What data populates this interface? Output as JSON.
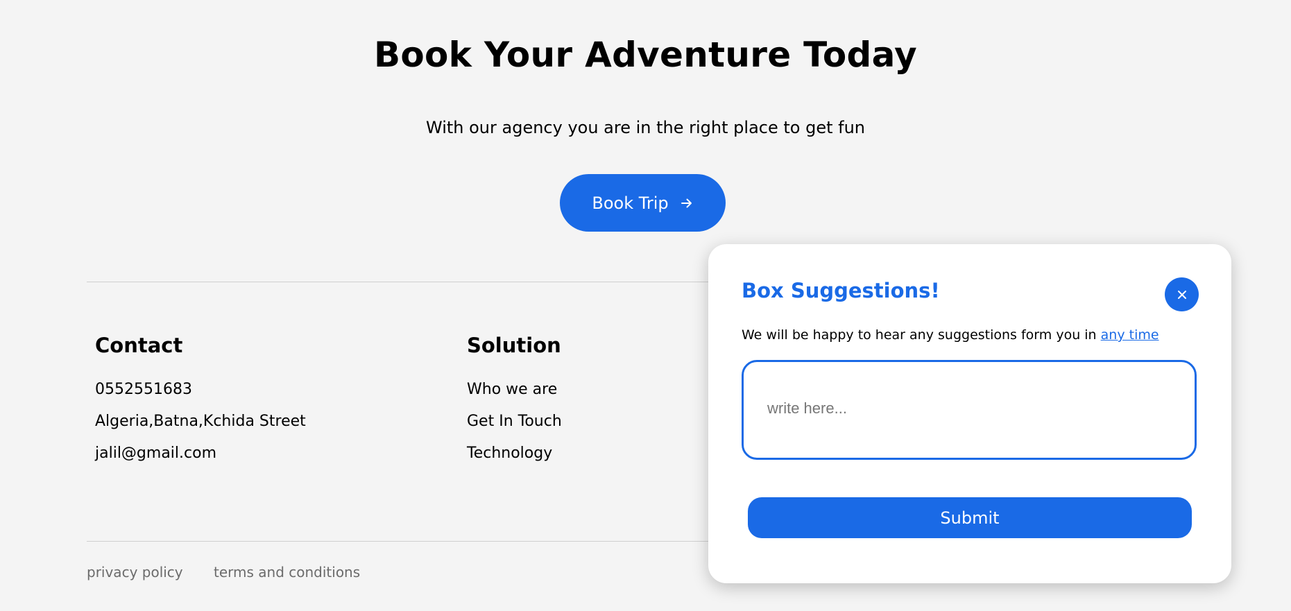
{
  "hero": {
    "title": "Book Your Adventure Today",
    "subtitle": "With our agency you are in the right place to get fun",
    "book_button_label": "Book Trip",
    "book_button_icon": "arrow-right-icon"
  },
  "footer": {
    "contact": {
      "title": "Contact",
      "items": [
        "0552551683",
        "Algeria,Batna,Kchida Street",
        "jalil@gmail.com"
      ]
    },
    "solution": {
      "title": "Solution",
      "items": [
        "Who we are",
        "Get In Touch",
        "Technology"
      ]
    },
    "legal": {
      "privacy": "privacy policy",
      "terms": "terms and conditions"
    }
  },
  "suggestion_box": {
    "title": "Box Suggestions!",
    "close_icon": "close-icon",
    "message": "We will be happy to hear any suggestions form you in",
    "link_text": "any time",
    "textarea_placeholder": "write here...",
    "submit_label": "Submit"
  },
  "colors": {
    "accent": "#1a6ae6",
    "background": "#f4f4f4",
    "modal_background": "#ffffff",
    "muted_text": "#6b6b6b"
  }
}
